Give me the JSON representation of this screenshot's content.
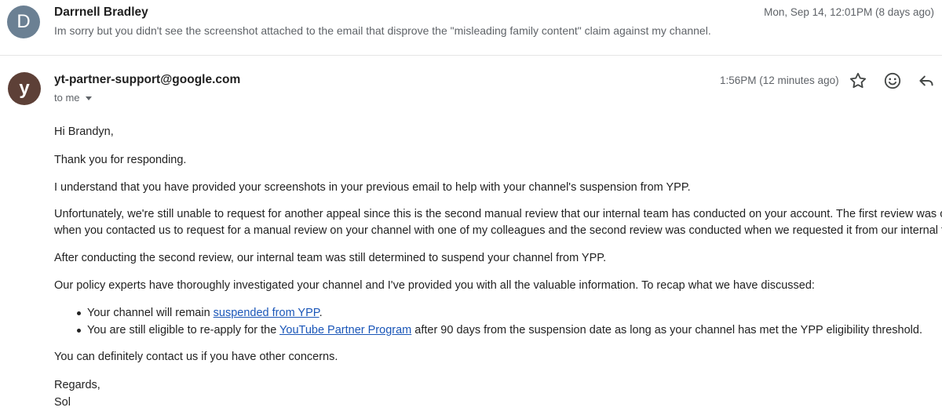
{
  "previous_message": {
    "avatar_letter": "D",
    "avatar_color": "#6b8093",
    "sender": "Darrnell Bradley",
    "snippet": "Im sorry but you didn't see the screenshot attached to the email that disprove the \"misleading family content\" claim against my channel.",
    "date": "Mon, Sep 14, 12:01PM (8 days ago)"
  },
  "current_message": {
    "avatar_letter": "y",
    "avatar_color": "#5d4037",
    "sender": "yt-partner-support@google.com",
    "to_label": "to me",
    "date": "1:56PM (12 minutes ago)",
    "actions": [
      "star-icon",
      "emoji-reaction-icon",
      "reply-icon"
    ],
    "body": {
      "greeting": "Hi Brandyn,",
      "p1": "Thank you for responding.",
      "p2": "I understand that you have provided your screenshots in your previous email to help with your channel's suspension from YPP.",
      "p3_line1": "Unfortunately, we're still unable to request for another appeal since this is the second manual review that our internal team has conducted on your account. The first review was conducted",
      "p3_line2": "when you contacted us to request for a manual review on your channel with one of my colleagues and the second review was conducted when we requested it from our internal team.",
      "p4": "After conducting the second review, our internal team was still determined to suspend your channel from YPP.",
      "p5": "Our policy experts have thoroughly investigated your channel and I've provided you with all the valuable information. To recap what we have discussed:",
      "bullet1_pre": "Your channel will remain ",
      "bullet1_link": "suspended from YPP",
      "bullet1_post": ".",
      "bullet2_pre": "You are still eligible to re-apply for the ",
      "bullet2_link": "YouTube Partner Program",
      "bullet2_post": " after 90 days from the suspension date as long as your channel has met the YPP eligibility threshold.",
      "p6": "You can definitely contact us if you have other concerns.",
      "closing": "Regards,",
      "signature": "Sol"
    }
  }
}
